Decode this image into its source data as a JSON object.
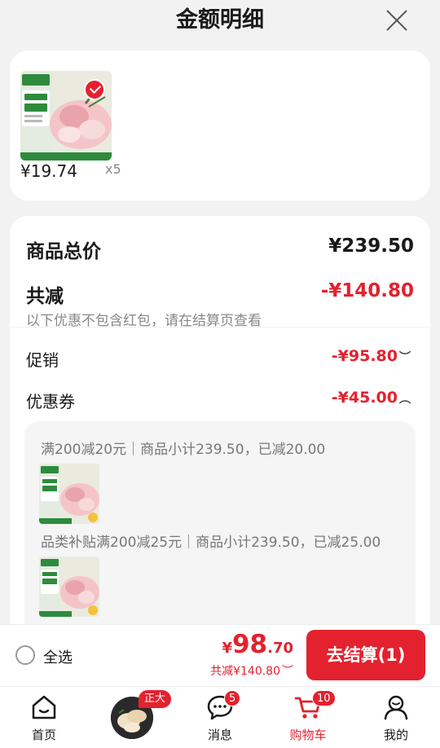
{
  "header": {
    "title": "金额明细"
  },
  "selected_item": {
    "price": "¥19.74",
    "qty": "x5"
  },
  "summary": {
    "total_label": "商品总价",
    "total_value": "¥239.50",
    "discount_label": "共减",
    "discount_value": "-¥140.80",
    "discount_hint": "以下优惠不包含红包，请在结算页查看",
    "promo_label": "促销",
    "promo_value": "-¥95.80",
    "coupon_label": "优惠券",
    "coupon_value": "-¥45.00"
  },
  "coupons": [
    {
      "text": "满200减20元｜商品小计239.50，已减20.00"
    },
    {
      "text": "品类补贴满200减25元｜商品小计239.50，已减25.00"
    }
  ],
  "checkout": {
    "select_all": "全选",
    "currency": "¥",
    "amount_int": "98",
    "amount_dec": ".70",
    "saved": "共减¥140.80",
    "button": "去结算(1)"
  },
  "tabbar": {
    "items": [
      {
        "label": "首页",
        "icon": "home-icon"
      },
      {
        "label": "",
        "icon": "promo-avatar",
        "tag": "正大"
      },
      {
        "label": "消息",
        "icon": "message-icon",
        "badge": "5"
      },
      {
        "label": "购物车",
        "icon": "cart-icon",
        "badge": "10"
      },
      {
        "label": "我的",
        "icon": "profile-icon"
      }
    ]
  },
  "colors": {
    "accent": "#e4212f",
    "text": "#1a1a1a",
    "muted": "#888888"
  }
}
